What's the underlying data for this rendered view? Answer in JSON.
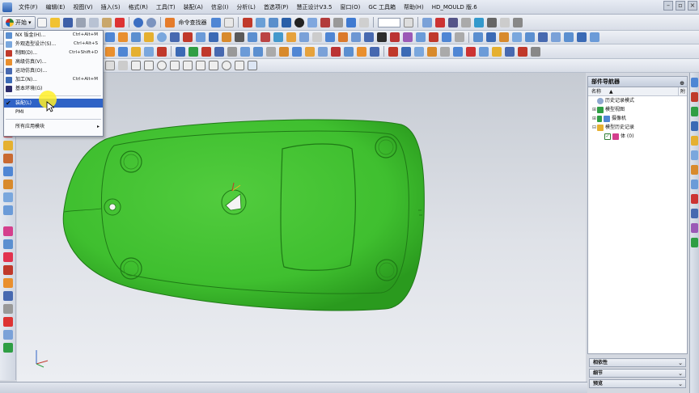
{
  "menubar": {
    "items": [
      "文件(F)",
      "编辑(E)",
      "视图(V)",
      "插入(S)",
      "格式(R)",
      "工具(T)",
      "装配(A)",
      "信息(I)",
      "分析(L)",
      "首选项(P)",
      "慧正设计V3.5",
      "窗口(O)",
      "GC 工具箱",
      "帮助(H)",
      "HD_MOULD 版.6"
    ]
  },
  "toolbar": {
    "start_label": "开始",
    "command_finder_label": "命令查找器"
  },
  "start_menu": {
    "items": [
      {
        "label": "NX 钣金(H)...",
        "shortcut": "Ctrl+Alt+M"
      },
      {
        "label": "外观造型设计(S)...",
        "shortcut": "Ctrl+Alt+S"
      },
      {
        "label": "制图(D)...",
        "shortcut": "Ctrl+Shift+D"
      },
      {
        "label": "高级仿真(V)...",
        "shortcut": ""
      },
      {
        "label": "运动仿真(O)...",
        "shortcut": ""
      },
      {
        "label": "加工(N)...",
        "shortcut": "Ctrl+Alt+M"
      },
      {
        "label": "基本环境(G)",
        "shortcut": ""
      },
      {
        "label": "装配(L)",
        "shortcut": ""
      },
      {
        "label": "PMI",
        "shortcut": ""
      },
      {
        "label": "所有应用模块",
        "shortcut": ""
      }
    ]
  },
  "navigator": {
    "title": "部件导航器",
    "col_name": "名称",
    "col_flag": "附",
    "sort_glyph": "▲",
    "tree": [
      {
        "label": "历史记录模式"
      },
      {
        "label": "模型视图"
      },
      {
        "label": "摄像机"
      },
      {
        "label": "模型历史记录"
      },
      {
        "label": "体 (0)"
      }
    ]
  },
  "panels": {
    "dependencies": "相依性",
    "details": "细节",
    "preview": "预览"
  },
  "colors": {
    "model_green": "#3fbf2f",
    "selection_blue": "#2f63c6",
    "highlight_yellow": "#ffee28"
  }
}
